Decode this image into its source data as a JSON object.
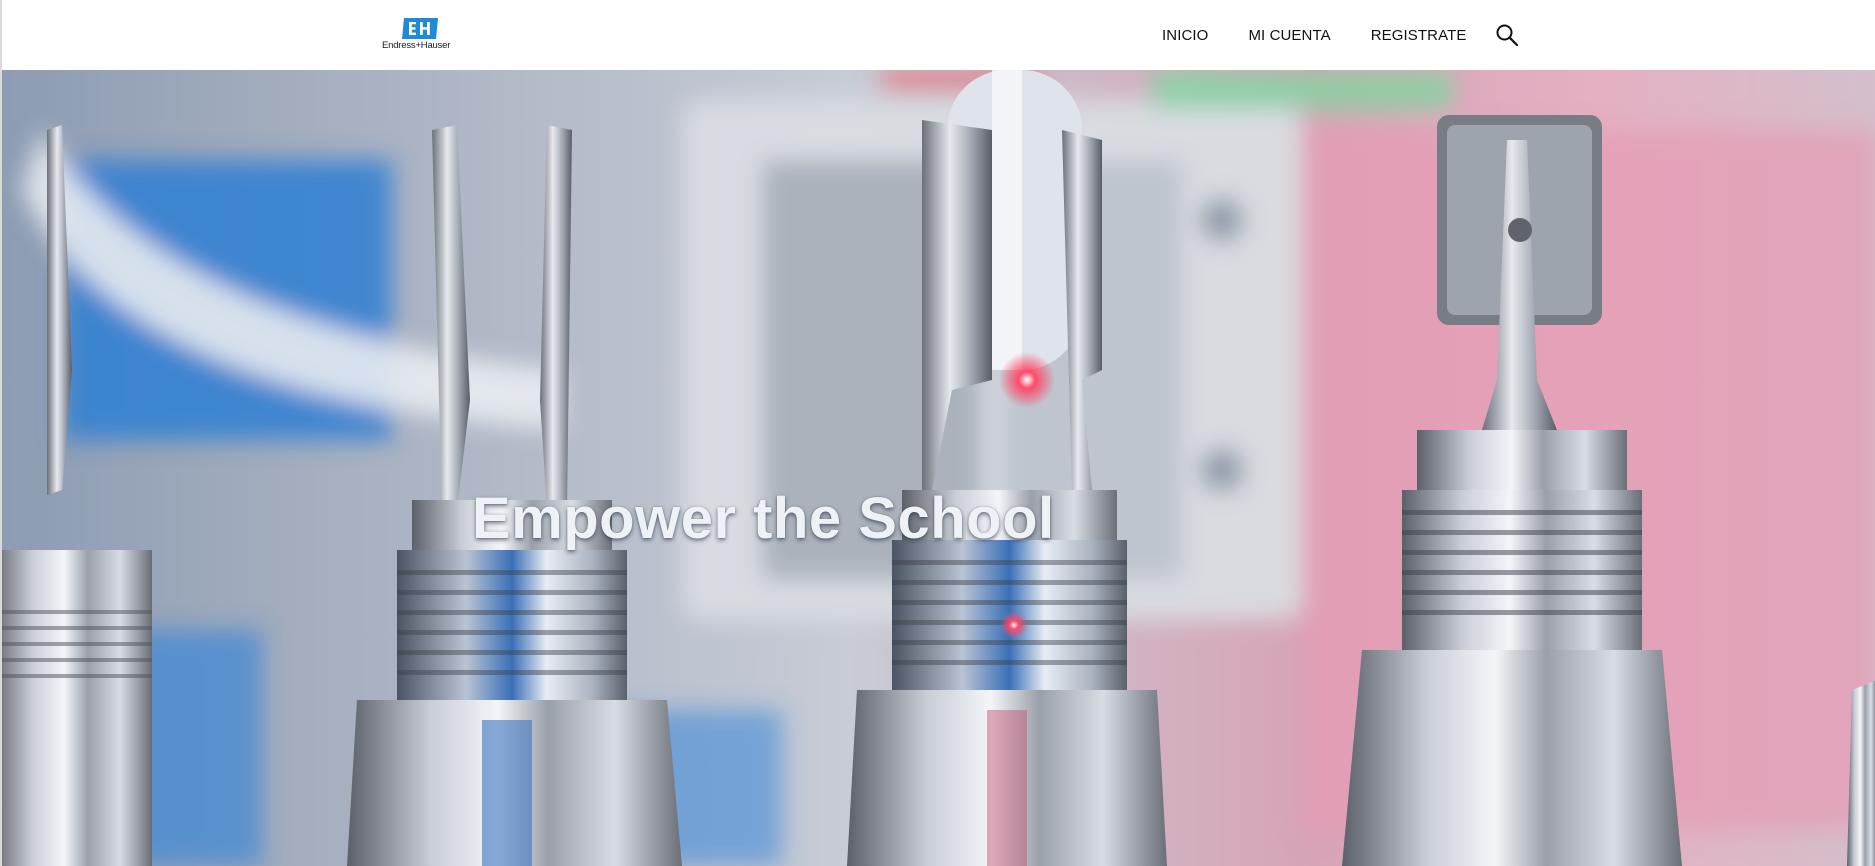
{
  "brand": {
    "name": "Endress+Hauser",
    "mark_letters": "EH",
    "color": "#1f8bd6"
  },
  "nav": {
    "items": [
      {
        "label": "INICIO"
      },
      {
        "label": "MI CUENTA"
      },
      {
        "label": "REGISTRATE"
      }
    ],
    "search_icon": "search-icon"
  },
  "hero": {
    "title": "Empower the School",
    "background": "photo of metal tuning-fork level sensors in a factory with blurred blue and pink background"
  },
  "colors": {
    "header_bg": "#ffffff",
    "nav_text": "#111111",
    "hero_title": "#eef2f6"
  }
}
